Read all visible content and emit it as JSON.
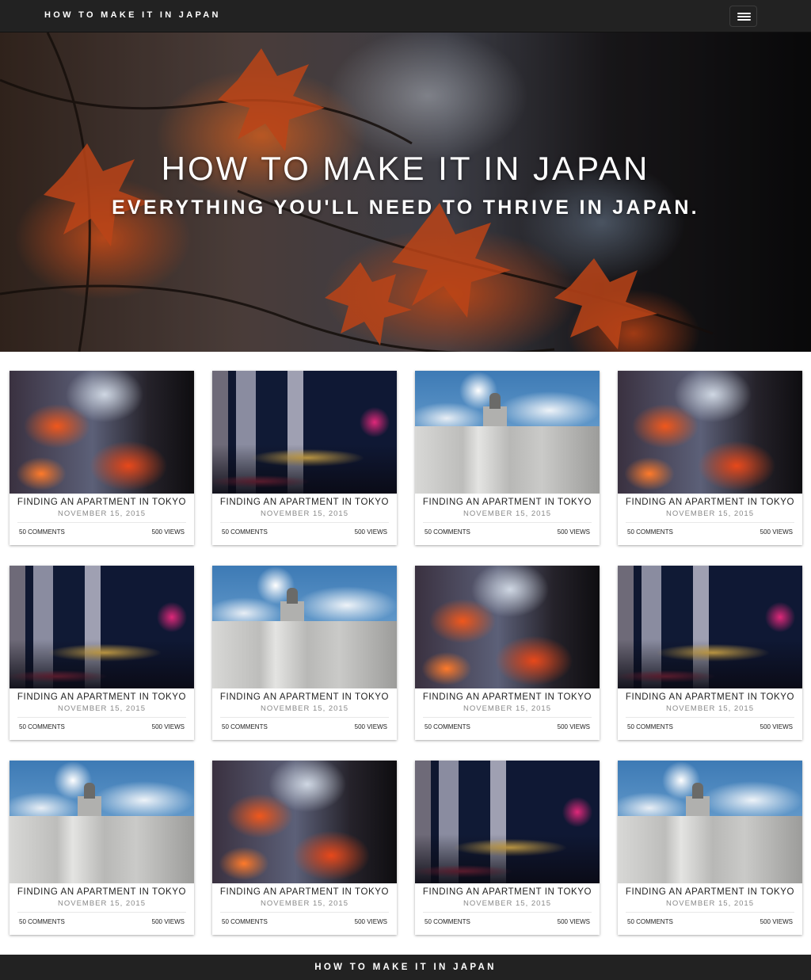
{
  "navbar": {
    "brand": "HOW TO MAKE IT IN JAPAN",
    "menu_icon": "hamburger-menu-icon"
  },
  "hero": {
    "title": "HOW TO MAKE IT IN JAPAN",
    "subtitle": "EVERYTHING YOU'LL NEED TO THRIVE IN JAPAN."
  },
  "posts": [
    {
      "image": "maple-leaves",
      "title": "FINDING AN APARTMENT IN TOKYO",
      "date": "NOVEMBER 15, 2015",
      "comments": "50 COMMENTS",
      "views": "500 VIEWS"
    },
    {
      "image": "night-city",
      "title": "FINDING AN APARTMENT IN TOKYO",
      "date": "NOVEMBER 15, 2015",
      "comments": "50 COMMENTS",
      "views": "500 VIEWS"
    },
    {
      "image": "cloudy-building",
      "title": "FINDING AN APARTMENT IN TOKYO",
      "date": "NOVEMBER 15, 2015",
      "comments": "50 COMMENTS",
      "views": "500 VIEWS"
    },
    {
      "image": "maple-leaves",
      "title": "FINDING AN APARTMENT IN TOKYO",
      "date": "NOVEMBER 15, 2015",
      "comments": "50 COMMENTS",
      "views": "500 VIEWS"
    },
    {
      "image": "night-city",
      "title": "FINDING AN APARTMENT IN TOKYO",
      "date": "NOVEMBER 15, 2015",
      "comments": "50 COMMENTS",
      "views": "500 VIEWS"
    },
    {
      "image": "cloudy-building",
      "title": "FINDING AN APARTMENT IN TOKYO",
      "date": "NOVEMBER 15, 2015",
      "comments": "50 COMMENTS",
      "views": "500 VIEWS"
    },
    {
      "image": "maple-leaves",
      "title": "FINDING AN APARTMENT IN TOKYO",
      "date": "NOVEMBER 15, 2015",
      "comments": "50 COMMENTS",
      "views": "500 VIEWS"
    },
    {
      "image": "night-city",
      "title": "FINDING AN APARTMENT IN TOKYO",
      "date": "NOVEMBER 15, 2015",
      "comments": "50 COMMENTS",
      "views": "500 VIEWS"
    },
    {
      "image": "cloudy-building",
      "title": "FINDING AN APARTMENT IN TOKYO",
      "date": "NOVEMBER 15, 2015",
      "comments": "50 COMMENTS",
      "views": "500 VIEWS"
    },
    {
      "image": "maple-leaves",
      "title": "FINDING AN APARTMENT IN TOKYO",
      "date": "NOVEMBER 15, 2015",
      "comments": "50 COMMENTS",
      "views": "500 VIEWS"
    },
    {
      "image": "night-city",
      "title": "FINDING AN APARTMENT IN TOKYO",
      "date": "NOVEMBER 15, 2015",
      "comments": "50 COMMENTS",
      "views": "500 VIEWS"
    },
    {
      "image": "cloudy-building",
      "title": "FINDING AN APARTMENT IN TOKYO",
      "date": "NOVEMBER 15, 2015",
      "comments": "50 COMMENTS",
      "views": "500 VIEWS"
    }
  ],
  "footer": {
    "text": "HOW TO MAKE IT IN JAPAN"
  },
  "colors": {
    "navbar": "#222222",
    "footer": "#222222",
    "background": "#ffffff"
  }
}
